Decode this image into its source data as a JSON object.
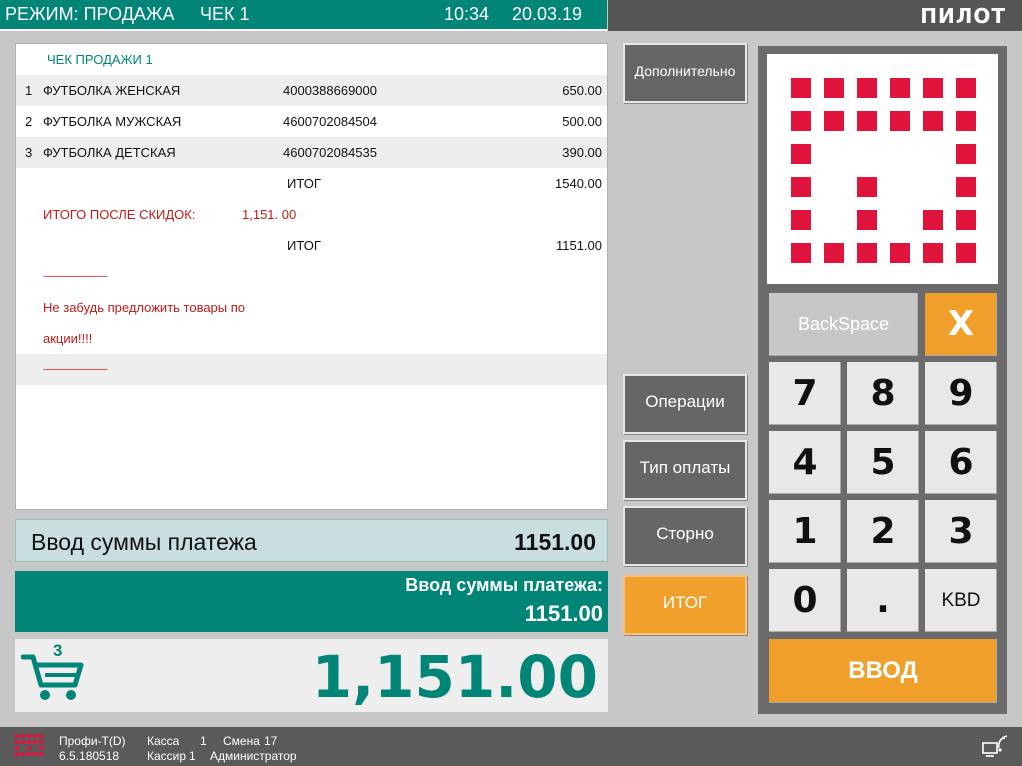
{
  "header": {
    "mode": "РЕЖИМ: ПРОДАЖА",
    "receipt": "ЧЕК 1",
    "time": "10:34",
    "date": "20.03.19",
    "brand": "ПИЛОТ"
  },
  "receipt": {
    "title": "ЧЕК  ПРОДАЖИ   1",
    "items": [
      {
        "num": "1",
        "name": "ФУТБОЛКА ЖЕНСКАЯ",
        "code": "4000388669000",
        "price": "650.00"
      },
      {
        "num": "2",
        "name": "ФУТБОЛКА МУЖСКАЯ",
        "code": "4600702084504",
        "price": "500.00"
      },
      {
        "num": "3",
        "name": "ФУТБОЛКА ДЕТСКАЯ",
        "code": "4600702084535",
        "price": "390.00"
      }
    ],
    "subtotal_label": "ИТОГ",
    "subtotal_value": "1540.00",
    "discount_label": "ИТОГО ПОСЛЕ СКИДОК:",
    "discount_value": "1,151. 00",
    "total_label": "ИТОГ",
    "total_value": "1151.00",
    "separator": "--------------------------------",
    "message_line1": "Не забудь предложить товары по",
    "message_line2": "акции!!!!",
    "separator2": "--------------------------------"
  },
  "payment": {
    "input_label": "Ввод суммы платежа",
    "input_value": "1151.00",
    "bar_label": "Ввод суммы платежа:",
    "bar_value": "1151.00"
  },
  "total": {
    "cart_count": "3",
    "amount": "1,151.00"
  },
  "buttons": {
    "extra": "Дополнительно",
    "operations": "Операции",
    "payment_type": "Тип оплаты",
    "storno": "Сторно",
    "itog": "ИТОГ"
  },
  "keypad": {
    "backspace": "BackSpace",
    "clear": "X",
    "k7": "7",
    "k8": "8",
    "k9": "9",
    "k4": "4",
    "k5": "5",
    "k6": "6",
    "k1": "1",
    "k2": "2",
    "k3": "3",
    "k0": "0",
    "dot": ".",
    "kbd": "KBD",
    "enter": "ВВОД"
  },
  "footer": {
    "product": "Профи-Т(D)",
    "version": "6.5.180518",
    "kassa_label": "Касса",
    "kassa_value": "1",
    "shift_label": "Смена",
    "shift_value": "17",
    "cashier_label": "Кассир",
    "cashier_value": "1",
    "cashier_name": "Администратор"
  },
  "colors": {
    "teal": "#008577",
    "orange": "#f0a02a",
    "logo_red": "#e0143c"
  }
}
